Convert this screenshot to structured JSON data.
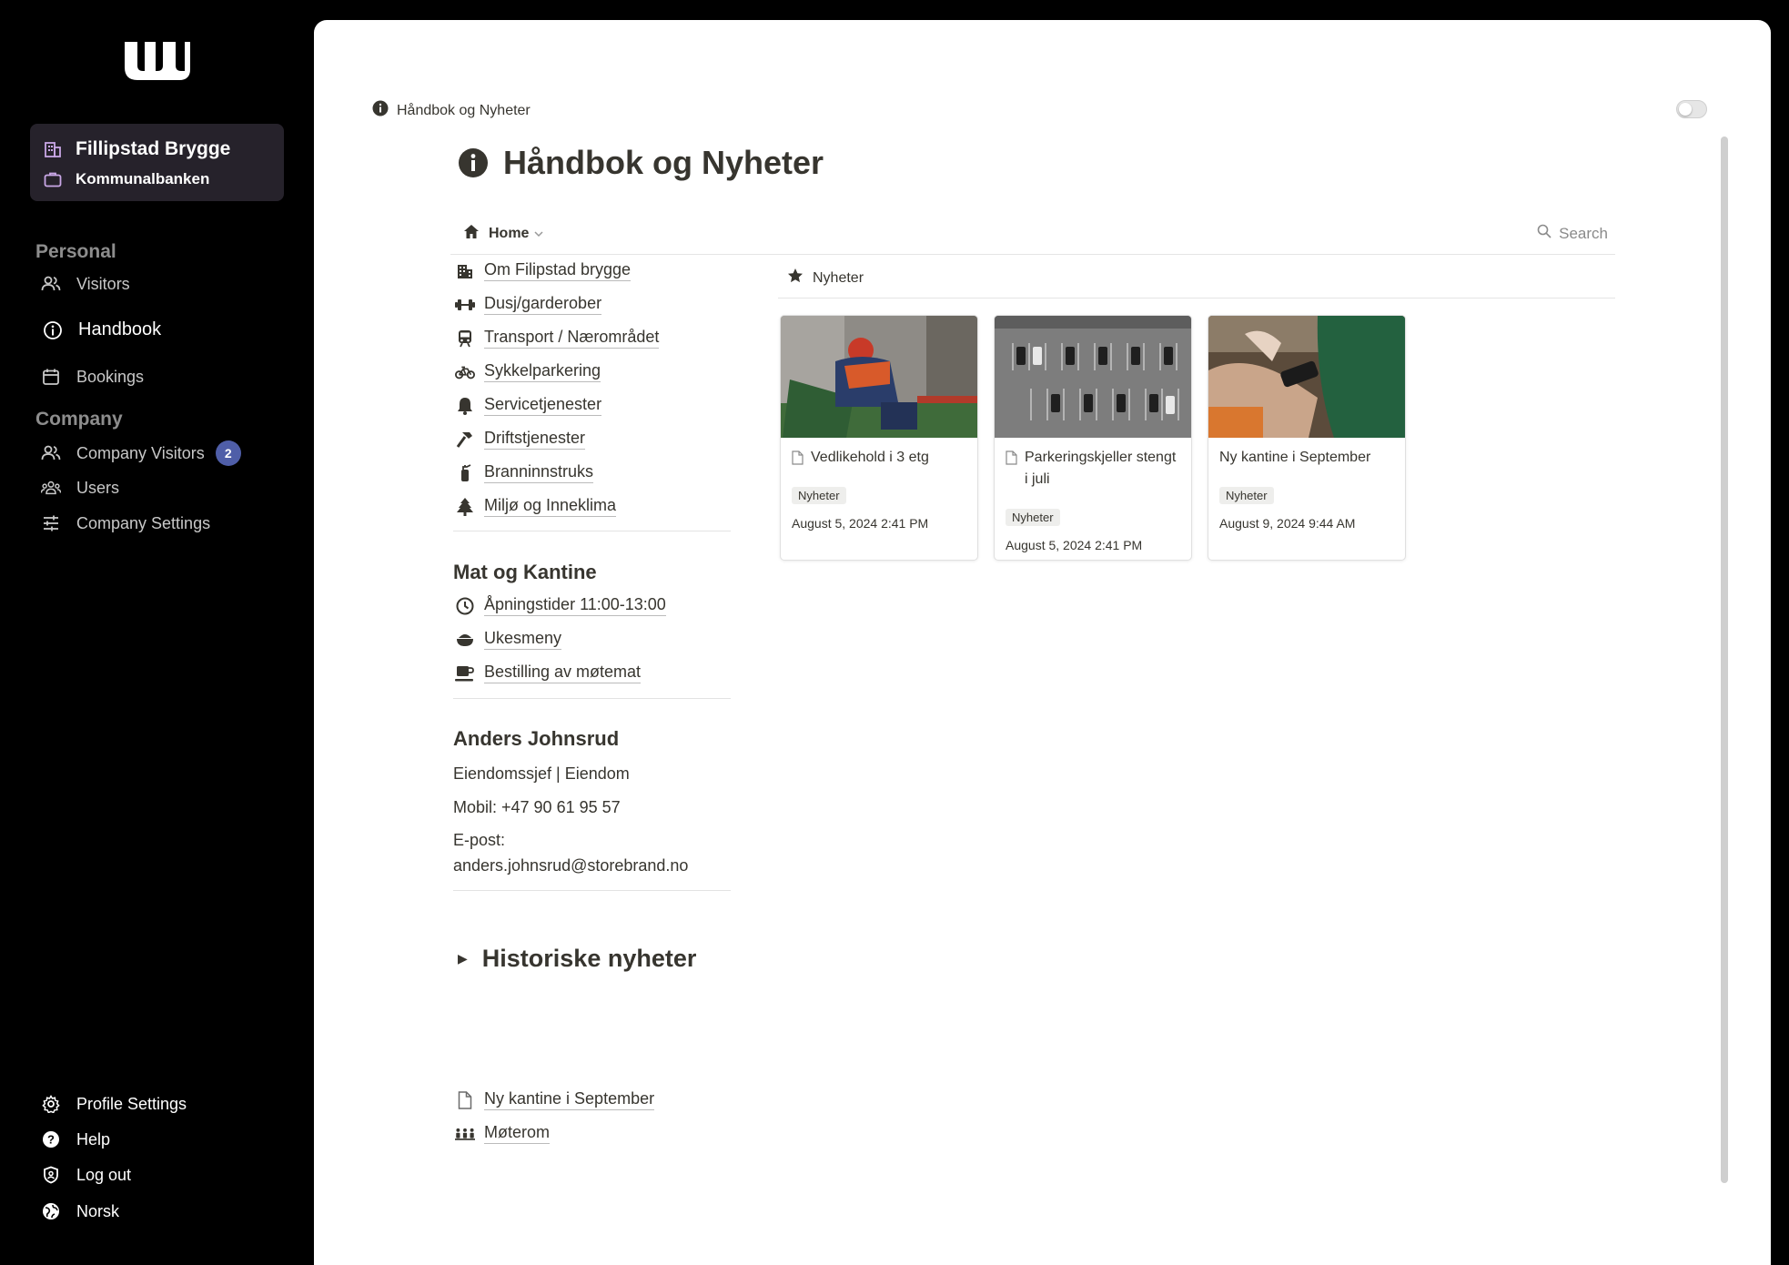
{
  "sidebar": {
    "org_name": "Fillipstad Brygge",
    "org_sub": "Kommunalbanken",
    "personal_title": "Personal",
    "company_title": "Company",
    "visitors": "Visitors",
    "handbook": "Handbook",
    "bookings": "Bookings",
    "company_visitors": "Company Visitors",
    "company_visitors_count": "2",
    "users": "Users",
    "company_settings": "Company Settings",
    "profile_settings": "Profile Settings",
    "help": "Help",
    "log_out": "Log out",
    "language": "Norsk"
  },
  "main": {
    "breadcrumb": "Håndbok og Nyheter",
    "title": "Håndbok og Nyheter",
    "tab_home": "Home",
    "search": "Search",
    "links": [
      {
        "label": "Om Filipstad brygge",
        "icon": "building-icon"
      },
      {
        "label": "Dusj/garderober",
        "icon": "dumbbell-icon"
      },
      {
        "label": "Transport / Nærområdet",
        "icon": "train-icon"
      },
      {
        "label": "Sykkelparkering",
        "icon": "bicycle-icon"
      },
      {
        "label": "Servicetjenester",
        "icon": "bell-icon"
      },
      {
        "label": "Driftstjenester",
        "icon": "hammer-icon"
      },
      {
        "label": "Branninnstruks",
        "icon": "fire-extinguisher-icon"
      },
      {
        "label": "Miljø og Inneklima",
        "icon": "tree-icon"
      }
    ],
    "food_title": "Mat og Kantine",
    "food_links": [
      {
        "label": "Åpningstider 11:00-13:00",
        "icon": "clock-icon"
      },
      {
        "label": "Ukesmeny",
        "icon": "bowl-icon"
      },
      {
        "label": "Bestilling av møtemat",
        "icon": "coffee-icon"
      }
    ],
    "contact": {
      "name": "Anders Johnsrud",
      "role": "Eiendomssjef | Eiendom",
      "mobile": "Mobil: +47 90 61 95 57",
      "email_label": "E-post:",
      "email": "anders.johnsrud@storebrand.no"
    },
    "historic": "Historiske nyheter",
    "bottom_links": [
      {
        "label": "Ny kantine i September",
        "icon": "page-icon"
      },
      {
        "label": "Møterom",
        "icon": "people-icon"
      }
    ],
    "news_header": "Nyheter",
    "news": [
      {
        "title": "Vedlikehold i 3 etg",
        "tag": "Nyheter",
        "date": "August 5, 2024 2:41 PM"
      },
      {
        "title": "Parkeringskjeller stengt i juli",
        "tag": "Nyheter",
        "date": "August 5, 2024 2:41 PM"
      },
      {
        "title": "Ny kantine i September",
        "tag": "Nyheter",
        "date": "August 9, 2024 9:44 AM"
      }
    ]
  }
}
